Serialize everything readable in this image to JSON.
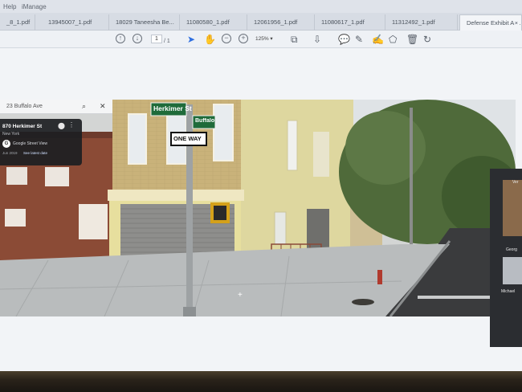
{
  "menubar": {
    "items": [
      "Help",
      "iManage"
    ]
  },
  "tabs": [
    {
      "label": "_8_1.pdf"
    },
    {
      "label": "13945007_1.pdf"
    },
    {
      "label": "18029 Taneesha Be..."
    },
    {
      "label": "11080580_1.pdf"
    },
    {
      "label": "12061956_1.pdf"
    },
    {
      "label": "11080617_1.pdf"
    },
    {
      "label": "11312492_1.pdf"
    },
    {
      "label": "Defense Exhibit A - ...",
      "active": true
    }
  ],
  "toolbar": {
    "page_current": "1",
    "page_total": "/ 1",
    "zoom": "125%"
  },
  "streetview": {
    "search_query": "23 Buffalo Ave",
    "address": "870 Herkimer St",
    "city": "New York",
    "source": "Google Street View",
    "capture_date": "Jun 2019",
    "see_more": "See latest date",
    "street_signs": [
      "Herkimer St",
      "Buffalo Av"
    ],
    "one_way_sign": "ONE WAY"
  },
  "right_panel": {
    "labels": [
      "Ver",
      "Georg",
      "Michael"
    ]
  },
  "colors": {
    "accent": "#2f6fe0",
    "card_bg": "#1c1e22",
    "sign_green": "#1f6b3a"
  }
}
